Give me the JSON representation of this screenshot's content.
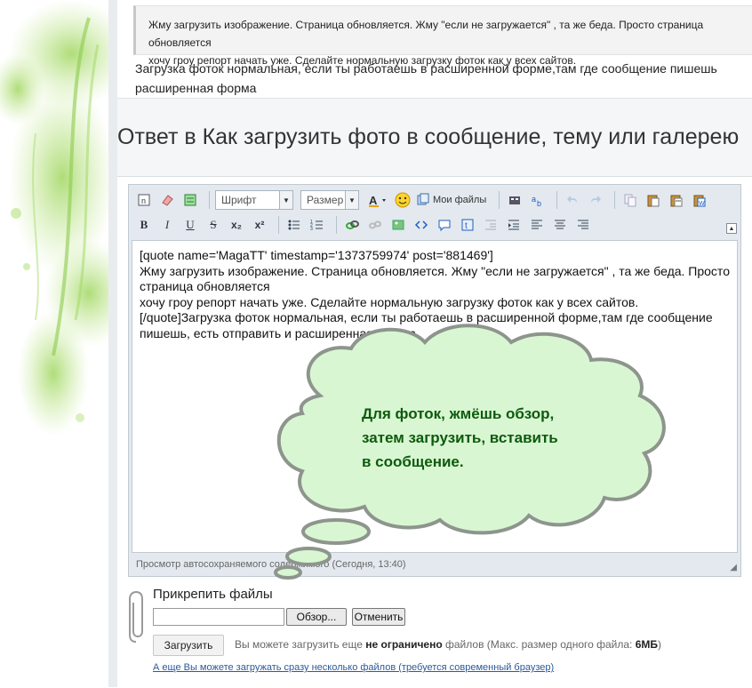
{
  "quote": {
    "text": "Жму загрузить изображение. Страница обновляется. Жму \"если не загружается\" , та же беда. Просто страница обновляется\nхочу гроу репорт начать уже. Сделайте нормальную загрузку фоток как у всех сайтов.",
    "reply": "Загрузка фоток нормальная, если ты работаешь в расширенной форме,там где сообщение пишешь\nрасширенная форма"
  },
  "heading": "Ответ в Как загрузить фото в сообщение, тему или галерею",
  "editor": {
    "font_label": "Шрифт",
    "size_label": "Размер",
    "my_files_label": "Мои файлы",
    "body_text": "[quote name='MagaTT' timestamp='1373759974' post='881469']\nЖму загрузить изображение. Страница обновляется. Жму \"если не загружается\" , та же беда. Просто страница обновляется\nхочу гроу репорт начать уже. Сделайте нормальную загрузку фоток как у всех сайтов.\n[/quote]Загрузка фоток нормальная, если ты работаешь в расширенной форме,там где сообщение пишешь, есть отправить и расширенная форма",
    "autosave": "Просмотр автосохраняемого содержимого (Сегодня, 13:40)"
  },
  "attach": {
    "title": "Прикрепить файлы",
    "browse_label": "Обзор...",
    "cancel_label": "Отменить",
    "upload_label": "Загрузить",
    "hint_prefix": "Вы можете загрузить еще ",
    "hint_bold": "не ограничено",
    "hint_middle": " файлов (Макс. размер одного файла: ",
    "hint_size": "6МБ",
    "hint_suffix": ")",
    "multi_link": "А еще Вы можете загружать сразу несколько файлов (требуется современный браузер)"
  },
  "callout": {
    "text": "Для фоток, жмёшь обзор,\nзатем загрузить, вставить\nв сообщение.",
    "fill_color": "#d9f6d3",
    "stroke_color": "#9aa39a",
    "text_color": "#0d5a0d"
  },
  "icons": {
    "bold": "B",
    "italic": "I",
    "underline": "U",
    "strike": "S",
    "subscript": "x₂",
    "superscript": "x²"
  }
}
